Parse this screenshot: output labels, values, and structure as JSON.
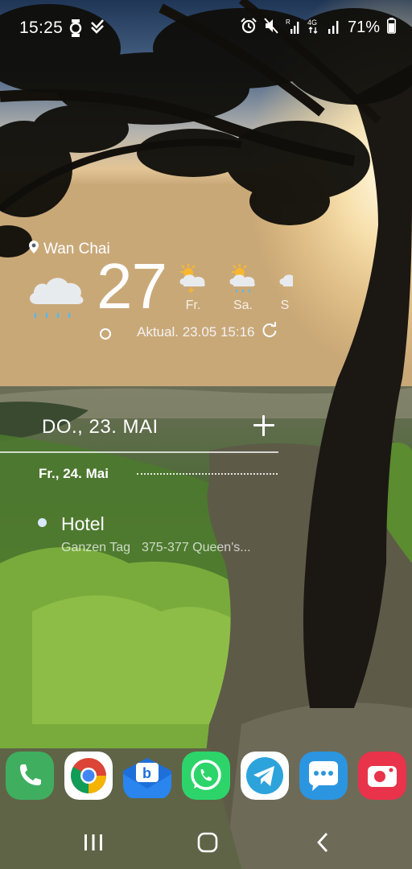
{
  "status_bar": {
    "time": "15:25",
    "battery_text": "71%",
    "icons_left": [
      "watch-icon",
      "check-notification-icon"
    ],
    "icons_right": [
      "alarm-icon",
      "mute-icon",
      "signal-r-icon",
      "network-4g-icon",
      "signal-icon",
      "battery-icon"
    ]
  },
  "weather": {
    "location": "Wan Chai",
    "temperature": "27",
    "condition_icon": "cloud-rain-icon",
    "forecast": [
      {
        "day": "Fr.",
        "icon": "sun-thunder-icon"
      },
      {
        "day": "Sa.",
        "icon": "sun-cloud-rain-icon"
      },
      {
        "day": "S",
        "icon": "cloud-icon"
      }
    ],
    "updated": "Aktual. 23.05 15:16"
  },
  "calendar": {
    "date_header": "DO., 23. MAI",
    "next_day": "Fr., 24. Mai",
    "event": {
      "title": "Hotel",
      "time": "Ganzen Tag",
      "location": "375-377 Queen's..."
    }
  },
  "dock": {
    "apps": [
      {
        "name": "Phone",
        "color": "#3fae5f"
      },
      {
        "name": "Chrome"
      },
      {
        "name": "Bluemail",
        "color": "#1e6fd9"
      },
      {
        "name": "WhatsApp",
        "color": "#2dd46a"
      },
      {
        "name": "Telegram",
        "color": "#2da3dc"
      },
      {
        "name": "Messages",
        "color": "#2b95e0"
      },
      {
        "name": "Screen Recorder",
        "color": "#e8334a"
      }
    ]
  },
  "navigation": {
    "buttons": [
      "recents-icon",
      "home-icon",
      "back-icon"
    ]
  }
}
